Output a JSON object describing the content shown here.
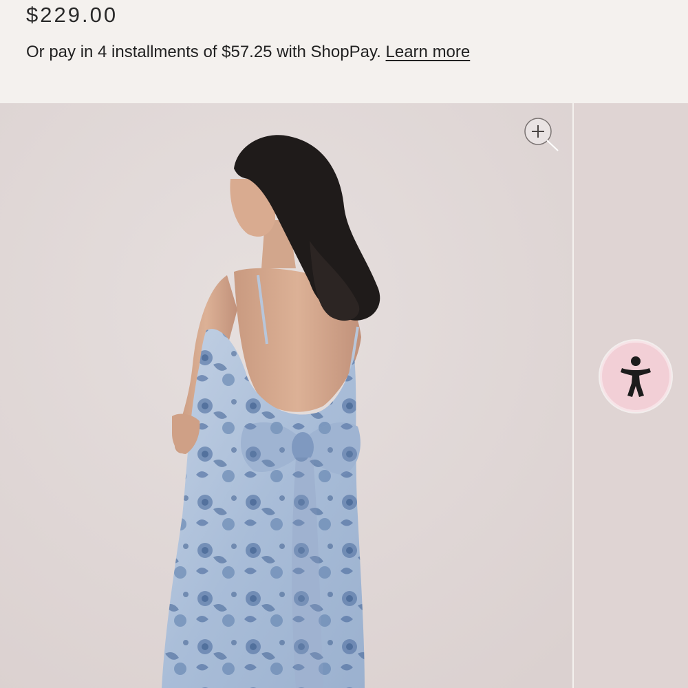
{
  "product": {
    "price": "$229.00",
    "installments_text": "Or pay in 4 installments of $57.25 with ShopPay.",
    "learn_more_label": "Learn more"
  },
  "gallery": {
    "zoom_icon": "zoom-in-icon",
    "image_subject": "model-back-view-floral-dress"
  },
  "accessibility": {
    "icon": "accessibility-person-icon"
  },
  "colors": {
    "page_bg": "#f4f1ee",
    "photo_bg": "#e1d8d7",
    "dress_blue": "#aabfd9",
    "print_blue": "#4f6f9e",
    "a11y_bg": "#f2cfd6"
  }
}
